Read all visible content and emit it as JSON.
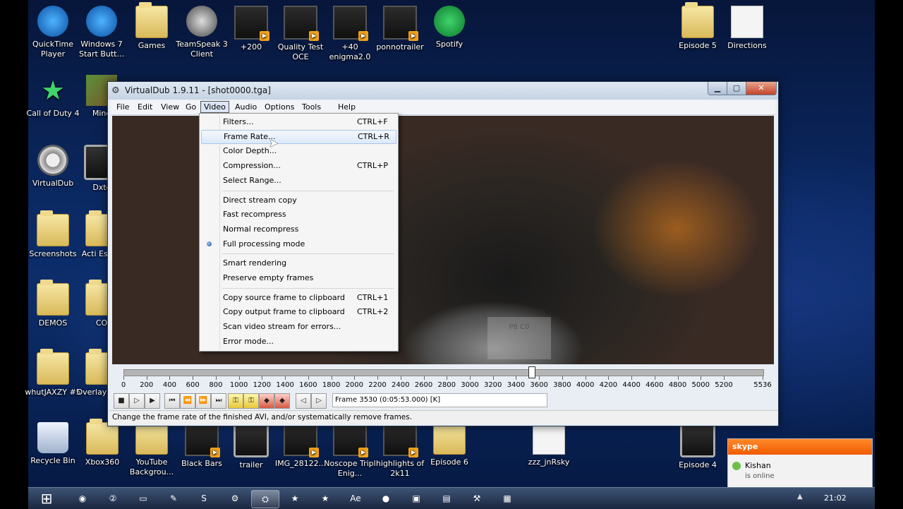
{
  "desktop": {
    "icons": [
      {
        "name": "QuickTime Player",
        "type": "round-blue"
      },
      {
        "name": "Windows 7 Start Butt...",
        "type": "round-blue"
      },
      {
        "name": "Games",
        "type": "folder"
      },
      {
        "name": "TeamSpeak 3 Client",
        "type": "ts"
      },
      {
        "name": "+200",
        "type": "film"
      },
      {
        "name": "Quality Test OCE",
        "type": "film"
      },
      {
        "name": "+40 enigma2.0",
        "type": "film"
      },
      {
        "name": "ponnotrailer",
        "type": "film"
      },
      {
        "name": "Spotify",
        "type": "round-green"
      },
      {
        "name": "Episode 5",
        "type": "folder"
      },
      {
        "name": "Directions",
        "type": "doc"
      },
      {
        "name": "Call of Duty 4",
        "type": "star"
      },
      {
        "name": "Mine",
        "type": "cube"
      },
      {
        "name": "VirtualDub",
        "type": "gear"
      },
      {
        "name": "Dxtc",
        "type": "tv"
      },
      {
        "name": "Screenshots",
        "type": "folder"
      },
      {
        "name": "Acti Essen",
        "type": "folder"
      },
      {
        "name": "DEMOS",
        "type": "folder"
      },
      {
        "name": "CO",
        "type": "folder"
      },
      {
        "name": "whutJAXZY #5",
        "type": "folder"
      },
      {
        "name": "Overlay Parti",
        "type": "folder"
      },
      {
        "name": "Recycle Bin",
        "type": "bin"
      },
      {
        "name": "Xbox360",
        "type": "folder"
      },
      {
        "name": "YouTube Backgrou...",
        "type": "folder"
      },
      {
        "name": "Black Bars",
        "type": "film"
      },
      {
        "name": "trailer",
        "type": "tv"
      },
      {
        "name": "IMG_28122...",
        "type": "film"
      },
      {
        "name": "Noscope Tripl Enig...",
        "type": "film"
      },
      {
        "name": "highlights of 2k11",
        "type": "film"
      },
      {
        "name": "Episode 6",
        "type": "folder"
      },
      {
        "name": "zzz_jnRsky",
        "type": "doc"
      },
      {
        "name": "Episode 4",
        "type": "tv"
      }
    ]
  },
  "window": {
    "title": "VirtualDub 1.9.11 - [shot0000.tga]",
    "app_icon": "gear-icon",
    "controls": {
      "minimize": "▁",
      "maximize": "▢",
      "close": "✕"
    },
    "menubar": [
      "File",
      "Edit",
      "View",
      "Go",
      "Video",
      "Audio",
      "Options",
      "Tools",
      "Help"
    ],
    "active_menu": "Video",
    "video_menu": [
      {
        "label": "Filters...",
        "shortcut": "CTRL+F"
      },
      {
        "label": "Frame Rate...",
        "shortcut": "CTRL+R",
        "highlighted": true
      },
      {
        "label": "Color Depth...",
        "shortcut": ""
      },
      {
        "label": "Compression...",
        "shortcut": "CTRL+P"
      },
      {
        "label": "Select Range...",
        "shortcut": ""
      },
      {
        "separator": true
      },
      {
        "label": "Direct stream copy",
        "shortcut": ""
      },
      {
        "label": "Fast recompress",
        "shortcut": ""
      },
      {
        "label": "Normal recompress",
        "shortcut": ""
      },
      {
        "label": "Full processing mode",
        "shortcut": "",
        "radio": true
      },
      {
        "separator": true
      },
      {
        "label": "Smart rendering",
        "shortcut": ""
      },
      {
        "label": "Preserve empty frames",
        "shortcut": ""
      },
      {
        "separator": true
      },
      {
        "label": "Copy source frame to clipboard",
        "shortcut": "CTRL+1"
      },
      {
        "label": "Copy output frame to clipboard",
        "shortcut": "CTRL+2"
      },
      {
        "label": "Scan video stream for errors...",
        "shortcut": ""
      },
      {
        "label": "Error mode...",
        "shortcut": ""
      }
    ],
    "video_overlay_text": "P8 C0",
    "timeline": {
      "max": 5536,
      "current": 3530,
      "ticks": [
        "0",
        "200",
        "400",
        "600",
        "800",
        "1000",
        "1200",
        "1400",
        "1600",
        "1800",
        "2000",
        "2200",
        "2400",
        "2600",
        "2800",
        "3000",
        "3200",
        "3400",
        "3600",
        "3800",
        "4000",
        "4200",
        "4400",
        "4600",
        "4800",
        "5000",
        "5200",
        "5536"
      ]
    },
    "frame_readout": "Frame 3530 (0:05:53.000) [K]",
    "status_text": "Change the frame rate of the finished AVI, and/or systematically remove frames."
  },
  "taskbar": {
    "start_glyph": "⊞",
    "items": [
      {
        "icon": "chrome-icon",
        "glyph": "◉"
      },
      {
        "icon": "media-icon",
        "glyph": "②"
      },
      {
        "icon": "window-icon",
        "glyph": "▭"
      },
      {
        "icon": "pen-icon",
        "glyph": "✎"
      },
      {
        "icon": "skype-icon",
        "glyph": "S"
      },
      {
        "icon": "steam-icon",
        "glyph": "⚙"
      },
      {
        "icon": "virtualdub-icon",
        "glyph": "⛭"
      },
      {
        "icon": "cod4-icon",
        "glyph": "★"
      },
      {
        "icon": "cod4-icon",
        "glyph": "★"
      },
      {
        "icon": "ae-icon",
        "glyph": "Ae"
      },
      {
        "icon": "record-icon",
        "glyph": "●"
      },
      {
        "icon": "display-icon",
        "glyph": "▣"
      },
      {
        "icon": "notepad-icon",
        "glyph": "▤"
      },
      {
        "icon": "tool-icon",
        "glyph": "⚒"
      },
      {
        "icon": "folder-icon",
        "glyph": "▦"
      }
    ],
    "clock": "21:02",
    "tray_arrow": "▲"
  },
  "notification": {
    "app": "skype",
    "name": "Kishan",
    "status": "is online"
  }
}
